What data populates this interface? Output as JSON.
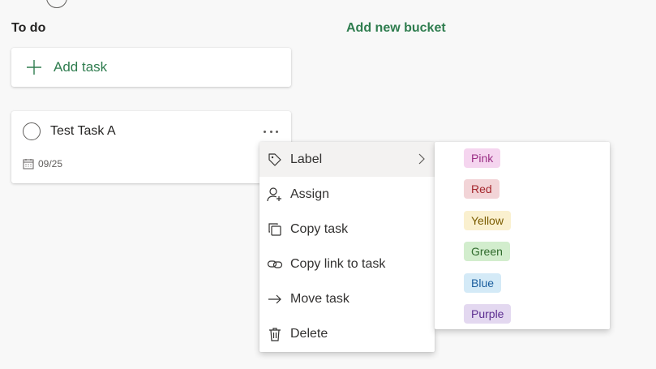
{
  "bucket": {
    "title": "To do",
    "add_bucket_label": "Add new bucket",
    "add_task_label": "Add task"
  },
  "task": {
    "title": "Test Task A",
    "due_date": "09/25"
  },
  "context_menu": {
    "items": [
      {
        "label": "Label",
        "icon": "tag-icon",
        "has_submenu": true
      },
      {
        "label": "Assign",
        "icon": "person-add-icon"
      },
      {
        "label": "Copy task",
        "icon": "copy-icon"
      },
      {
        "label": "Copy link to task",
        "icon": "link-icon"
      },
      {
        "label": "Move task",
        "icon": "arrow-right-icon"
      },
      {
        "label": "Delete",
        "icon": "trash-icon"
      }
    ]
  },
  "labels": [
    {
      "name": "Pink",
      "bg": "#f5d5ef",
      "fg": "#9b2f85"
    },
    {
      "name": "Red",
      "bg": "#f2d4d7",
      "fg": "#a4262c"
    },
    {
      "name": "Yellow",
      "bg": "#faf0cf",
      "fg": "#7a5b00"
    },
    {
      "name": "Green",
      "bg": "#d2edcd",
      "fg": "#2f6a2c"
    },
    {
      "name": "Blue",
      "bg": "#d4eaf7",
      "fg": "#1b5e9e"
    },
    {
      "name": "Purple",
      "bg": "#e3d8f0",
      "fg": "#5c2e91"
    }
  ],
  "colors": {
    "accent_green": "#2f7d4f",
    "menu_hover": "#f3f2f1"
  }
}
